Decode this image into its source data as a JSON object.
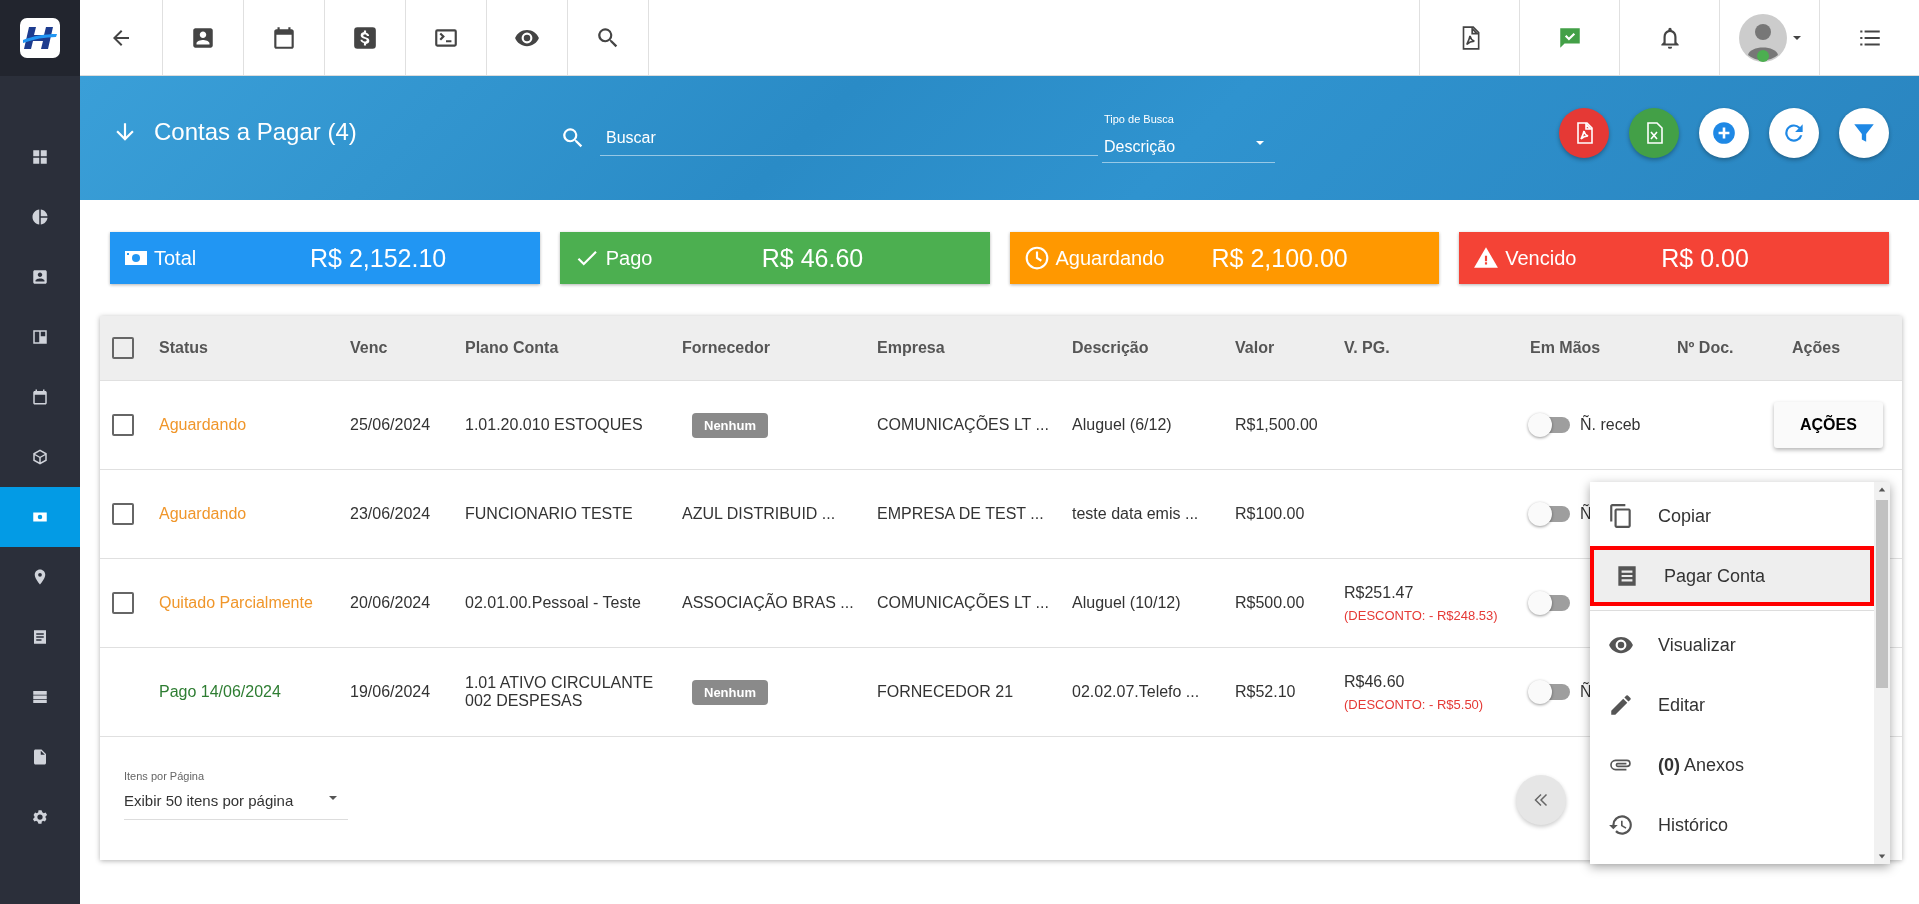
{
  "sidebar": {
    "items": [
      {
        "selected": false
      },
      {
        "selected": false
      },
      {
        "selected": false
      },
      {
        "selected": false
      },
      {
        "selected": false
      },
      {
        "selected": false
      },
      {
        "selected": true
      },
      {
        "selected": false
      },
      {
        "selected": false
      },
      {
        "selected": false
      },
      {
        "selected": false
      },
      {
        "selected": false
      }
    ]
  },
  "header": {
    "title": "Contas a Pagar (4)",
    "search": {
      "placeholder": "Buscar"
    },
    "search_type": {
      "label": "Tipo de Busca",
      "value": "Descrição"
    }
  },
  "cards": [
    {
      "kind": "total",
      "label": "Total",
      "value": "R$ 2,152.10"
    },
    {
      "kind": "paid",
      "label": "Pago",
      "value": "R$ 46.60"
    },
    {
      "kind": "waiting",
      "label": "Aguardando",
      "value": "R$ 2,100.00"
    },
    {
      "kind": "overdue",
      "label": "Vencido",
      "value": "R$ 0.00"
    }
  ],
  "table": {
    "header_checkbox": {
      "checked": false
    },
    "columns": [
      "Status",
      "Venc",
      "Plano Conta",
      "Fornecedor",
      "Empresa",
      "Descrição",
      "Valor",
      "V. PG.",
      "Em Mãos",
      "Nº Doc.",
      "Ações"
    ],
    "rows": [
      {
        "selectable": true,
        "checked": false,
        "status": "Aguardando",
        "color": "#f0962a",
        "venc": "25/06/2024",
        "plano": [
          "1.01.20.010 ESTOQUES"
        ],
        "fornecedor": {
          "kind": "chip",
          "text": "Nenhum"
        },
        "empresa": "COMUNICAÇÕES LT ...",
        "descricao": "Aluguel (6/12)",
        "valor": "R$1,500.00",
        "em_maos": {
          "on": false,
          "text": "Ñ. receb"
        },
        "action": "AÇÕES"
      },
      {
        "selectable": true,
        "checked": false,
        "status": "Aguardando",
        "color": "#f0962a",
        "venc": "23/06/2024",
        "plano": [
          "FUNCIONARIO TESTE"
        ],
        "fornecedor": {
          "kind": "text",
          "text": "AZUL DISTRIBUID ..."
        },
        "empresa": "EMPRESA DE TEST ...",
        "descricao": "teste data emis ...",
        "valor": "R$100.00",
        "em_maos": {
          "on": false,
          "text": "Ñ"
        }
      },
      {
        "selectable": true,
        "checked": false,
        "status": "Quitado Parcialmente",
        "color": "#f0962a",
        "venc": "20/06/2024",
        "plano": [
          "02.01.00.Pessoal - Teste"
        ],
        "fornecedor": {
          "kind": "text",
          "text": "ASSOCIAÇÃO BRAS ..."
        },
        "empresa": "COMUNICAÇÕES LT ...",
        "descricao": "Aluguel (10/12)",
        "valor": "R$500.00",
        "v_pg": "R$251.47",
        "discount": "(DESCONTO: - R$248.53)",
        "em_maos": {
          "on": false
        }
      },
      {
        "selectable": false,
        "status": "Pago 14/06/2024",
        "color": "#2e7d32",
        "venc": "19/06/2024",
        "plano": [
          "1.01 ATIVO CIRCULANTE",
          "002 DESPESAS"
        ],
        "fornecedor": {
          "kind": "chip",
          "text": "Nenhum"
        },
        "empresa": "FORNECEDOR 21",
        "descricao": "02.02.07.Telefo ...",
        "valor": "R$52.10",
        "v_pg": "R$46.60",
        "discount": "(DESCONTO: - R$5.50)",
        "em_maos": {
          "on": false,
          "text": "Ñ"
        }
      }
    ]
  },
  "pagination": {
    "label": "Itens por Página",
    "value": "Exibir 50 itens por página"
  },
  "menu": {
    "items": [
      {
        "label": "Copiar",
        "selected": false
      },
      {
        "label": "Pagar Conta",
        "selected": true
      },
      {
        "label": "Visualizar",
        "selected": false
      },
      {
        "label": "Editar",
        "selected": false
      },
      {
        "label": "**(0)** Anexos",
        "selected": false
      },
      {
        "label": "Histórico",
        "selected": false
      }
    ]
  }
}
